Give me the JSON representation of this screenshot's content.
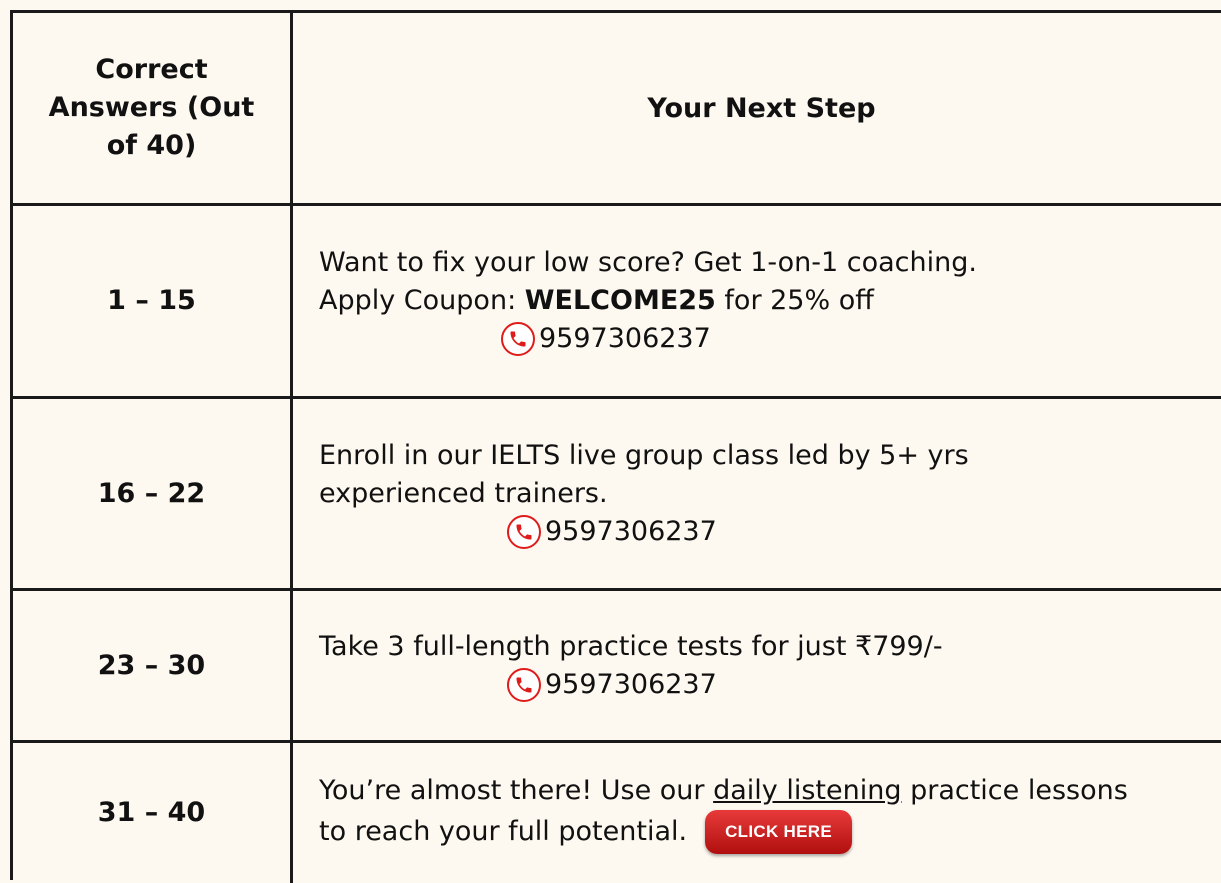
{
  "header": {
    "col1": "Correct Answers (Out of 40)",
    "col2": "Your Next Step"
  },
  "rows": [
    {
      "range": "1 – 15",
      "line1": "Want to fix your low score? Get 1-on-1 coaching.",
      "line2_prefix": "Apply Coupon: ",
      "line2_code": "WELCOME25",
      "line2_suffix": " for 25% off",
      "phone": "9597306237"
    },
    {
      "range": "16 – 22",
      "line1": "Enroll in our IELTS live group class led by 5+ yrs",
      "line2": "experienced trainers.",
      "phone": "9597306237"
    },
    {
      "range": "23 – 30",
      "line1": "Take 3 full-length practice tests for just ₹799/-",
      "phone": "9597306237"
    },
    {
      "range": "31 – 40",
      "line1_prefix": "You’re almost there! Use our ",
      "line1_link": "daily listening",
      "line1_suffix": " practice lessons",
      "line2": "to reach your full potential.",
      "cta": "CLICK HERE"
    }
  ],
  "icons": {
    "phone": "phone-icon"
  },
  "colors": {
    "accent": "#e01b1b",
    "background": "#fdf8f0",
    "border": "#1a1a1a"
  }
}
